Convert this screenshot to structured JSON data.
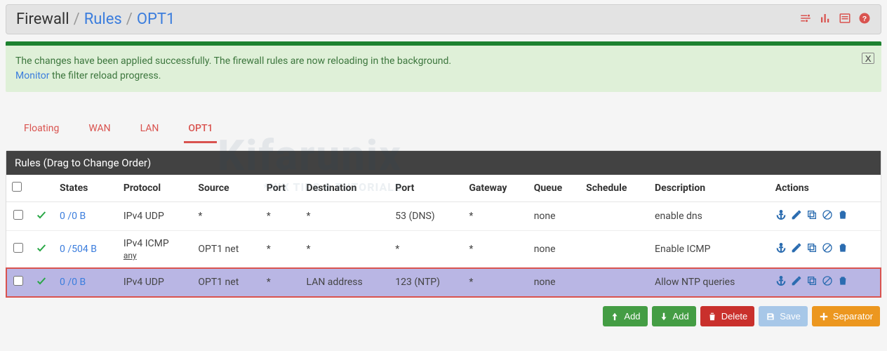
{
  "breadcrumb": {
    "root": "Firewall",
    "l1": "Rules",
    "l2": "OPT1"
  },
  "alert": {
    "text1": "The changes have been applied successfully. The firewall rules are now reloading in the background.",
    "link": "Monitor",
    "text2": " the filter reload progress."
  },
  "tabs": [
    "Floating",
    "WAN",
    "LAN",
    "OPT1"
  ],
  "active_tab": "OPT1",
  "panel_title": "Rules (Drag to Change Order)",
  "columns": [
    "",
    "",
    "States",
    "Protocol",
    "Source",
    "Port",
    "Destination",
    "Port",
    "Gateway",
    "Queue",
    "Schedule",
    "Description",
    "Actions"
  ],
  "rows": [
    {
      "states": "0 /0 B",
      "protocol": "IPv4 UDP",
      "proto_sub": "",
      "source": "*",
      "sport": "*",
      "dest": "*",
      "dport": "53 (DNS)",
      "gateway": "*",
      "queue": "none",
      "schedule": "",
      "desc": "enable dns",
      "highlight": false
    },
    {
      "states": "0 /504 B",
      "protocol": "IPv4 ICMP",
      "proto_sub": "any",
      "source": "OPT1 net",
      "sport": "*",
      "dest": "*",
      "dport": "*",
      "gateway": "*",
      "queue": "none",
      "schedule": "",
      "desc": "Enable ICMP",
      "highlight": false
    },
    {
      "states": "0 /0 B",
      "protocol": "IPv4 UDP",
      "proto_sub": "",
      "source": "OPT1 net",
      "sport": "*",
      "dest": "LAN address",
      "dport": "123 (NTP)",
      "gateway": "*",
      "queue": "none",
      "schedule": "",
      "desc": "Allow NTP queries",
      "highlight": true
    }
  ],
  "buttons": {
    "add_up": "Add",
    "add_down": "Add",
    "delete": "Delete",
    "save": "Save",
    "separator": "Separator"
  },
  "watermark": {
    "main": "Kifarunix",
    "sub": "*NIX TIPS & TUTORIALS"
  }
}
